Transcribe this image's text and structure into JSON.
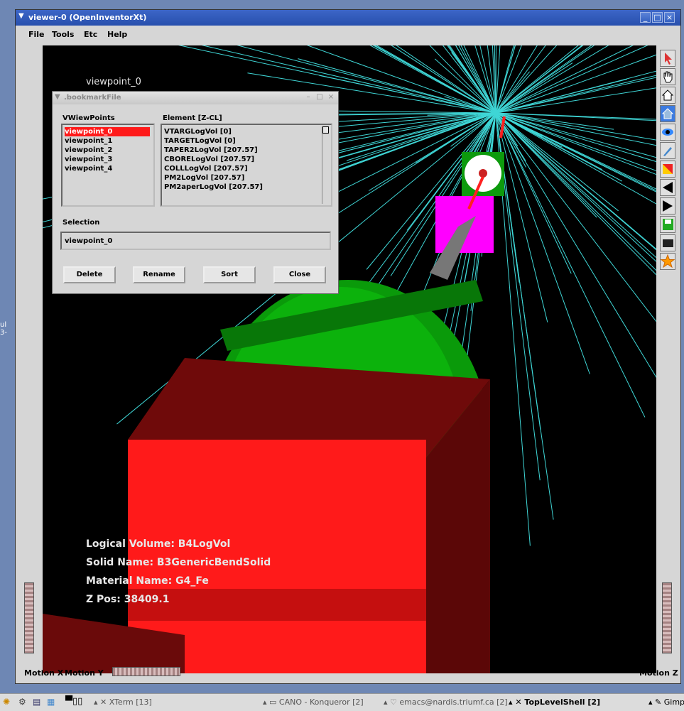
{
  "window": {
    "title": "viewer-0 (OpenInventorXt)",
    "controls": [
      "_",
      "□",
      "×"
    ]
  },
  "menubar": {
    "items": [
      "File",
      "Tools",
      "Etc",
      "Help"
    ]
  },
  "viewer": {
    "viewpoint_label": "viewpoint_0",
    "info": {
      "logical_volume": "Logical Volume: B4LogVol",
      "solid_name": "Solid Name: B3GenericBendSolid",
      "material_name": "Material Name: G4_Fe",
      "z_pos": "Z Pos: 38409.1"
    }
  },
  "right_toolbar": {
    "icons": [
      "pick-arrow-icon",
      "hand-icon",
      "home-icon",
      "set-home-icon",
      "eye-icon",
      "brush-icon",
      "drawstyle-icon",
      "left-arrow-icon",
      "right-arrow-icon",
      "save-icon",
      "screen-icon",
      "star-icon"
    ]
  },
  "bottom_bar": {
    "motion_x": "Motion X",
    "motion_y": "Motion Y",
    "motion_z": "Motion Z"
  },
  "dialog": {
    "title": ".bookmarkFile",
    "viewpoints_header": "VWiewPoints",
    "element_header": "Element [Z-CL]",
    "viewpoints": [
      "viewpoint_0",
      "viewpoint_1",
      "viewpoint_2",
      "viewpoint_3",
      "viewpoint_4"
    ],
    "selected_index": 0,
    "elements": [
      "VTARGLogVol [0]",
      "TARGETLogVol [0]",
      "TAPER2LogVol [207.57]",
      "CBORELogVol [207.57]",
      "COLLLogVol [207.57]",
      "PM2LogVol [207.57]",
      "PM2aperLogVol [207.57]"
    ],
    "selection_label": "Selection",
    "selection_value": "viewpoint_0",
    "buttons": {
      "delete": "Delete",
      "rename": "Rename",
      "sort": "Sort",
      "close": "Close"
    }
  },
  "left_edge_text": "ul\n3-",
  "taskbar": {
    "tasks": [
      "XTerm [13]",
      "CANO - Konqueror [2]",
      "emacs@nardis.triumf.ca [2]",
      "TopLevelShell [2]",
      "Gimp"
    ]
  }
}
